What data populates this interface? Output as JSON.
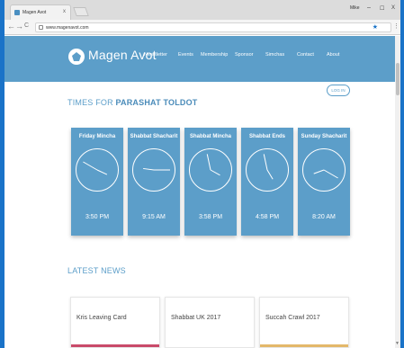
{
  "browser": {
    "tab_title": "Magen Avot",
    "tab_close": "x",
    "user": "Mike",
    "win_min": "–",
    "win_max": "☐",
    "win_close": "X",
    "back": "←",
    "forward": "→",
    "reload": "C",
    "url": "www.magenavot.com",
    "menu_dots": "⋮"
  },
  "nav": {
    "brand": "Magen Avot",
    "links": [
      "Newsletter",
      "Events",
      "Membership",
      "Sponsor",
      "Simchas",
      "Contact",
      "About"
    ]
  },
  "login_label": "LOG IN",
  "times": {
    "title_prefix": "TIMES FOR ",
    "title_bold": "PARASHAT TOLDOT",
    "cards": [
      {
        "label": "Friday Mincha",
        "time": "3:50 PM",
        "hour": 3,
        "minute": 50
      },
      {
        "label": "Shabbat Shacharit",
        "time": "9:15 AM",
        "hour": 9,
        "minute": 15
      },
      {
        "label": "Shabbat Mincha",
        "time": "3:58 PM",
        "hour": 3,
        "minute": 58
      },
      {
        "label": "Shabbat Ends",
        "time": "4:58 PM",
        "hour": 4,
        "minute": 58
      },
      {
        "label": "Sunday Shacharit",
        "time": "8:20 AM",
        "hour": 8,
        "minute": 20
      }
    ]
  },
  "news": {
    "title": "LATEST NEWS",
    "items": [
      {
        "headline": "Kris Leaving Card",
        "accent": "#c94a6a"
      },
      {
        "headline": "Shabbat UK 2017",
        "accent": "#ffffff"
      },
      {
        "headline": "Succah Crawl 2017",
        "accent": "#e3b86a"
      }
    ]
  },
  "colors": {
    "primary": "#5c9ec9",
    "frame": "#1a73c8"
  }
}
